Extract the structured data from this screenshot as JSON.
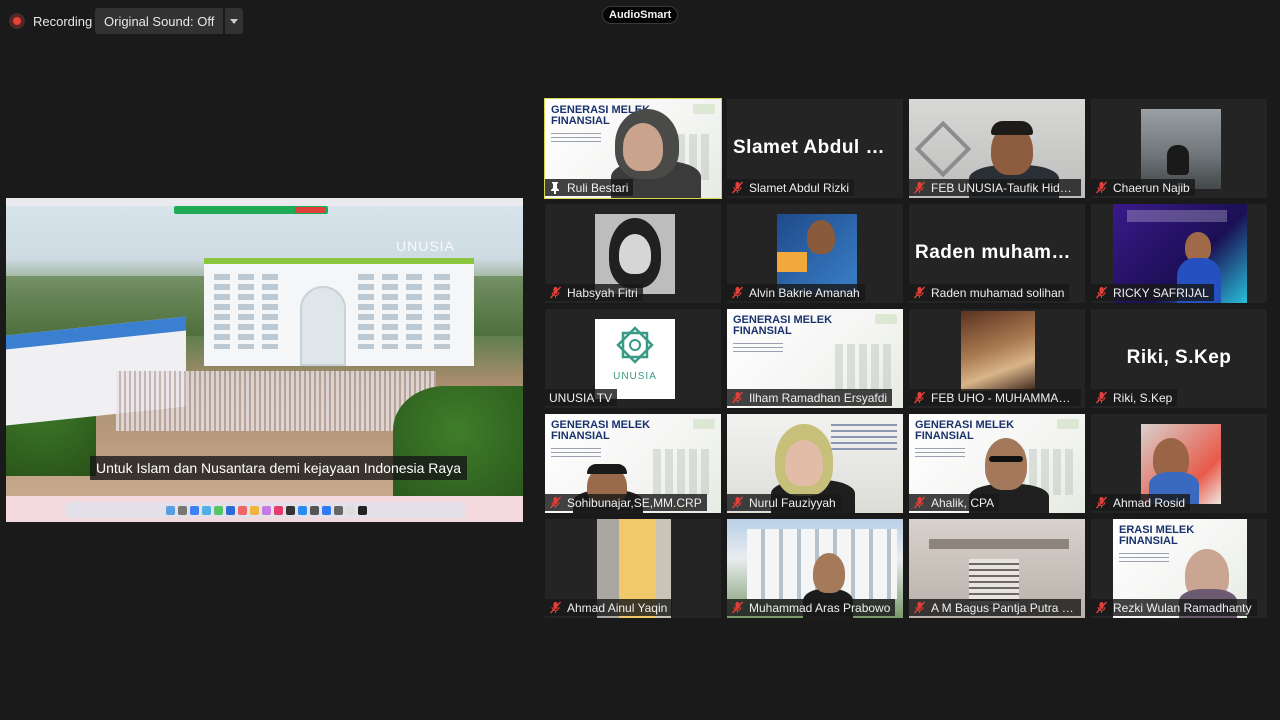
{
  "topbar": {
    "recording_label": "Recording",
    "original_sound_label": "Original Sound: Off",
    "brand": "AudioSmart"
  },
  "share": {
    "subtitle": "Untuk Islam dan Nusantara demi kejayaan Indonesia Raya",
    "watermark": "UNUSIA"
  },
  "colors": {
    "active_speaker_border": "#d8d94a",
    "muted_icon": "#e0403a",
    "tile_bg": "#242424",
    "recording_dot": "#e8413a"
  },
  "participants": [
    {
      "name": "Ruli Bestari",
      "pinned": true,
      "active": true,
      "slide_title": "GENERASI MELEK\nFINANSIAL"
    },
    {
      "name": "Slamet Abdul Rizki",
      "muted": true,
      "big_label": "Slamet Abdul R..."
    },
    {
      "name": "FEB UNUSIA-Taufik Hiday...",
      "muted": true
    },
    {
      "name": "Chaerun Najib",
      "muted": true
    },
    {
      "name": "Habsyah Fitri",
      "muted": true
    },
    {
      "name": "Alvin Bakrie Amanah",
      "muted": true
    },
    {
      "name": "Raden muhamad solihan",
      "muted": true,
      "big_label": "Raden muhama..."
    },
    {
      "name": "RICKY SAFRIJAL",
      "muted": true
    },
    {
      "name": "UNUSIA TV",
      "muted": false,
      "logo_text": "UNUSIA"
    },
    {
      "name": "Ilham Ramadhan Ersyafdi",
      "muted": true,
      "slide_title": "GENERASI MELEK\nFINANSIAL"
    },
    {
      "name": "FEB UHO - MUHAMMAD ...",
      "muted": true
    },
    {
      "name": "Riki, S.Kep",
      "muted": true,
      "big_label": "Riki, S.Kep"
    },
    {
      "name": "Sohibunajar,SE,MM.CRP",
      "muted": true,
      "slide_title": "GENERASI MELEK\nFINANSIAL"
    },
    {
      "name": "Nurul Fauziyyah",
      "muted": true
    },
    {
      "name": "Ahalik, CPA",
      "muted": true,
      "slide_title": "GENERASI MELEK\nFINANSIAL"
    },
    {
      "name": "Ahmad Rosid",
      "muted": true
    },
    {
      "name": "Ahmad Ainul Yaqin",
      "muted": true
    },
    {
      "name": "Muhammad Aras Prabowo",
      "muted": true
    },
    {
      "name": "A M Bagus Pantja Putra D...",
      "muted": true
    },
    {
      "name": "Rezki Wulan Ramadhanty",
      "muted": true,
      "slide_title": "ERASI MELEK\nFINANSIAL"
    }
  ]
}
